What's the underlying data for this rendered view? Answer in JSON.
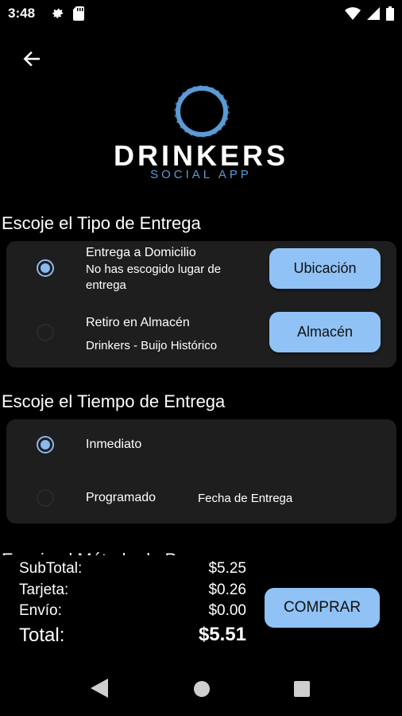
{
  "status": {
    "time": "3:48"
  },
  "logo": {
    "title": "DRINKERS",
    "subtitle": "SOCIAL APP",
    "accent": "#5b9bd5"
  },
  "delivery_type": {
    "heading": "Escoje el Tipo de Entrega",
    "options": [
      {
        "title": "Entrega a Domicilio",
        "detail": "No has escogido lugar de entrega",
        "button": "Ubicación",
        "selected": true
      },
      {
        "title": "Retiro en Almacén",
        "detail": "Drinkers - Buijo Histórico",
        "button": "Almacén",
        "selected": false
      }
    ]
  },
  "delivery_time": {
    "heading": "Escoje el Tiempo de Entrega",
    "options": [
      {
        "title": "Inmediato",
        "selected": true
      },
      {
        "title": "Programado",
        "detail": "Fecha de Entrega",
        "selected": false
      }
    ]
  },
  "payment": {
    "heading": "Escoje el Método de Pago"
  },
  "totals": {
    "subtotal_label": "SubTotal:",
    "subtotal_value": "$5.25",
    "card_label": "Tarjeta:",
    "card_value": "$0.26",
    "shipping_label": "Envío:",
    "shipping_value": "$0.00",
    "total_label": "Total:",
    "total_value": "$5.51"
  },
  "buy_button": "COMPRAR",
  "colors": {
    "background": "#000000",
    "card": "#1e1e1e",
    "button": "#90c2f5",
    "radio": "#8ab8f0"
  },
  "icons": [
    "settings-icon",
    "sd-card-icon",
    "wifi-icon",
    "signal-icon",
    "battery-icon",
    "back-arrow-icon",
    "nav-back-icon",
    "nav-home-icon",
    "nav-recents-icon"
  ]
}
